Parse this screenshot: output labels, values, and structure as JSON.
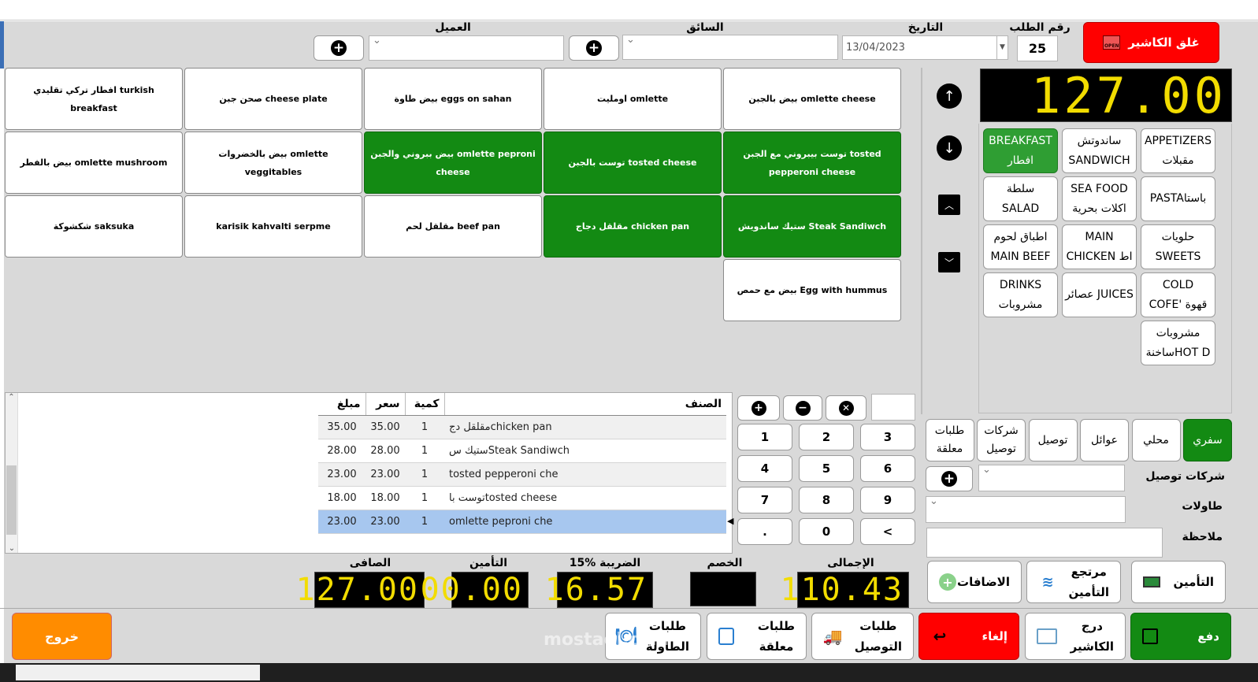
{
  "header": {
    "customer_label": "العميل",
    "driver_label": "السائق",
    "date_label": "التاريخ",
    "order_no_label": "رقم الطلب",
    "date_value": "13/04/2023",
    "order_no_value": "25",
    "close_cashier": "غلق الكاشير",
    "open_sign": "OPEN"
  },
  "menu_items": [
    {
      "label": "بيض بالجبن omlette cheese",
      "green": false
    },
    {
      "label": "اومليت omlette",
      "green": false
    },
    {
      "label": "بيض طاوة eggs on sahan",
      "green": false
    },
    {
      "label": "صحن جبن cheese plate",
      "green": false
    },
    {
      "label": "افطار تركي تقليدي turkish breakfast",
      "green": false
    },
    {
      "label": "توست بيبروني مع الجبن tosted pepperoni cheese",
      "green": true
    },
    {
      "label": "توست بالجبن tosted cheese",
      "green": true
    },
    {
      "label": "بيض ببروني والجبن omlette peproni cheese",
      "green": true
    },
    {
      "label": "بيض بالخضروات omlette veggitables",
      "green": false
    },
    {
      "label": "بيض بالفطر omlette mushroom",
      "green": false
    },
    {
      "label": "ستيك ساندويش Steak Sandiwch",
      "green": true
    },
    {
      "label": "مقلقل دجاج chicken pan",
      "green": true
    },
    {
      "label": "مقلقل لحم beef pan",
      "green": false
    },
    {
      "label": "karisik kahvalti serpme",
      "green": false
    },
    {
      "label": "شكشوكة saksuka",
      "green": false
    },
    {
      "label": "بيض مع حمص Egg with hummus",
      "green": false
    }
  ],
  "total_display": "127.00",
  "categories": [
    {
      "l1": "APPETIZERS",
      "l2": "مقبلات",
      "active": false
    },
    {
      "l1": "ساندوتش",
      "l2": "SANDWICH",
      "active": false
    },
    {
      "l1": "BREAKFAST",
      "l2": "افطار",
      "active": true
    },
    {
      "l1": "PASTAباستا",
      "l2": "",
      "active": false
    },
    {
      "l1": "SEA FOOD",
      "l2": "اكلات بحرية",
      "active": false
    },
    {
      "l1": "سلطة",
      "l2": "SALAD",
      "active": false
    },
    {
      "l1": "حلويات",
      "l2": "SWEETS",
      "active": false
    },
    {
      "l1": "MAIN",
      "l2": "CHICKEN اط",
      "active": false
    },
    {
      "l1": "اطباق لحوم",
      "l2": "MAIN BEEF",
      "active": false
    },
    {
      "l1": "COLD",
      "l2": "COFE' قهوة",
      "active": false
    },
    {
      "l1": "عصائر JUICES",
      "l2": "",
      "active": false
    },
    {
      "l1": "DRINKS",
      "l2": "مشروبات",
      "active": false
    },
    {
      "l1": "مشروبات",
      "l2": "ساخنةHOT D",
      "active": false
    }
  ],
  "order_table": {
    "headers": {
      "item": "الصنف",
      "qty": "كمية",
      "price": "سعر",
      "amount": "مبلغ"
    },
    "rows": [
      {
        "item": "مقلقل دجchicken pan",
        "qty": "1",
        "price": "35.00",
        "amount": "35.00"
      },
      {
        "item": "ستيك سSteak Sandiwch",
        "qty": "1",
        "price": "28.00",
        "amount": "28.00"
      },
      {
        "item": "tosted pepperoni che",
        "qty": "1",
        "price": "23.00",
        "amount": "23.00"
      },
      {
        "item": "توست باtosted cheese",
        "qty": "1",
        "price": "18.00",
        "amount": "18.00"
      },
      {
        "item": "omlette peproni  che",
        "qty": "1",
        "price": "23.00",
        "amount": "23.00"
      }
    ]
  },
  "keypad": [
    "1",
    "2",
    "3",
    "4",
    "5",
    "6",
    "7",
    "8",
    "9",
    ".",
    "0",
    "<"
  ],
  "order_types": [
    {
      "l1": "سفري",
      "l2": "",
      "active": true
    },
    {
      "l1": "محلي",
      "l2": "",
      "active": false
    },
    {
      "l1": "عوائل",
      "l2": "",
      "active": false
    },
    {
      "l1": "توصيل",
      "l2": "",
      "active": false
    },
    {
      "l1": "شركات",
      "l2": "توصيل",
      "active": false
    },
    {
      "l1": "طلبات",
      "l2": "معلقة",
      "active": false
    }
  ],
  "side_labels": {
    "delivery_companies": "شركات توصيل",
    "tables": "طاولات",
    "note": "ملاحظة"
  },
  "mid_actions": {
    "insurance": "التأمين",
    "insurance_return_1": "مرتجع",
    "insurance_return_2": "التأمين",
    "additions": "الاضافات"
  },
  "totals": {
    "net_label": "الصافى",
    "net": "127.00",
    "insurance_label": "التأمين",
    "insurance": "00.00",
    "tax_label": "الضريبة %15",
    "tax": "16.57",
    "discount_label": "الخصم",
    "discount": "",
    "total_label": "الإجمالى",
    "total": "110.43"
  },
  "bottom": {
    "exit": "خروج",
    "table_orders_1": "طلبات",
    "table_orders_2": "الطاولة",
    "pending_1": "طلبات",
    "pending_2": "معلقة",
    "delivery_1": "طلبات",
    "delivery_2": "التوصيل",
    "cancel": "إلغاء",
    "drawer_1": "درج",
    "drawer_2": "الكاشير",
    "pay": "دفع"
  },
  "watermark": "mostaql.com",
  "colors": {
    "green": "#138a13",
    "red": "#ff0000",
    "orange": "#ff8c00",
    "segment": "#f2dc00"
  }
}
